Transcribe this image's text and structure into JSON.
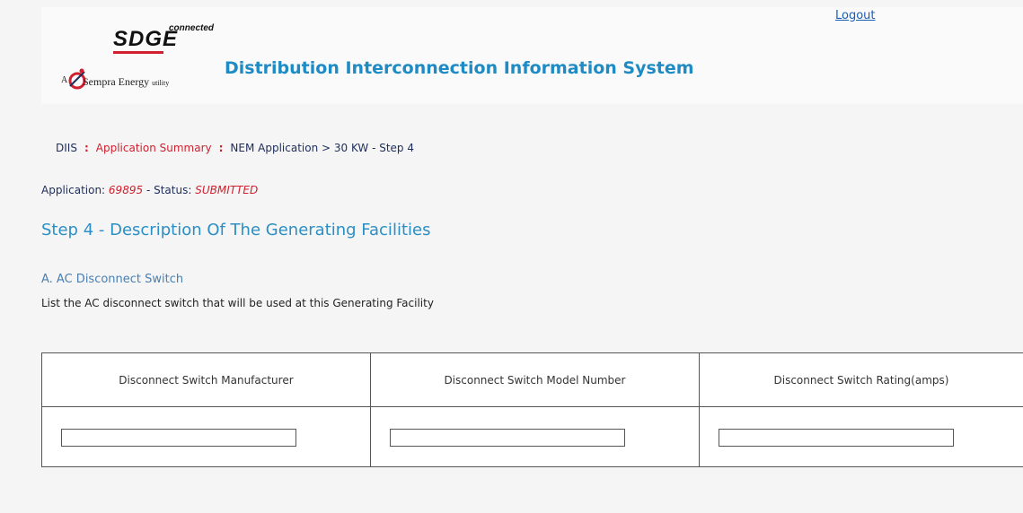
{
  "header": {
    "logo": {
      "brand": "SDGE",
      "superscript": "connected",
      "tagline_prefix": "A",
      "tagline_name": "Sempra Energy",
      "tagline_suffix": "utility"
    },
    "title": "Distribution Interconnection Information System",
    "logout_label": "Logout"
  },
  "breadcrumb": {
    "items": [
      "DIIS",
      "Application Summary",
      "NEM Application > 30 KW - Step 4"
    ],
    "separator": ":"
  },
  "application": {
    "label": "Application:",
    "id": "69895",
    "status_label": "- Status:",
    "status": "SUBMITTED"
  },
  "step_title": "Step 4 - Description Of The Generating Facilities",
  "section": {
    "title": "A. AC Disconnect Switch",
    "description": "List the AC disconnect switch that will be used at this Generating Facility"
  },
  "table": {
    "columns": [
      "Disconnect Switch Manufacturer",
      "Disconnect Switch Model Number",
      "Disconnect Switch Rating(amps)"
    ],
    "row": {
      "manufacturer": "",
      "model_number": "",
      "rating": ""
    }
  },
  "colors": {
    "title_blue": "#1f8bc4",
    "accent_red": "#d0202f",
    "text_navy": "#1e2d5a"
  }
}
